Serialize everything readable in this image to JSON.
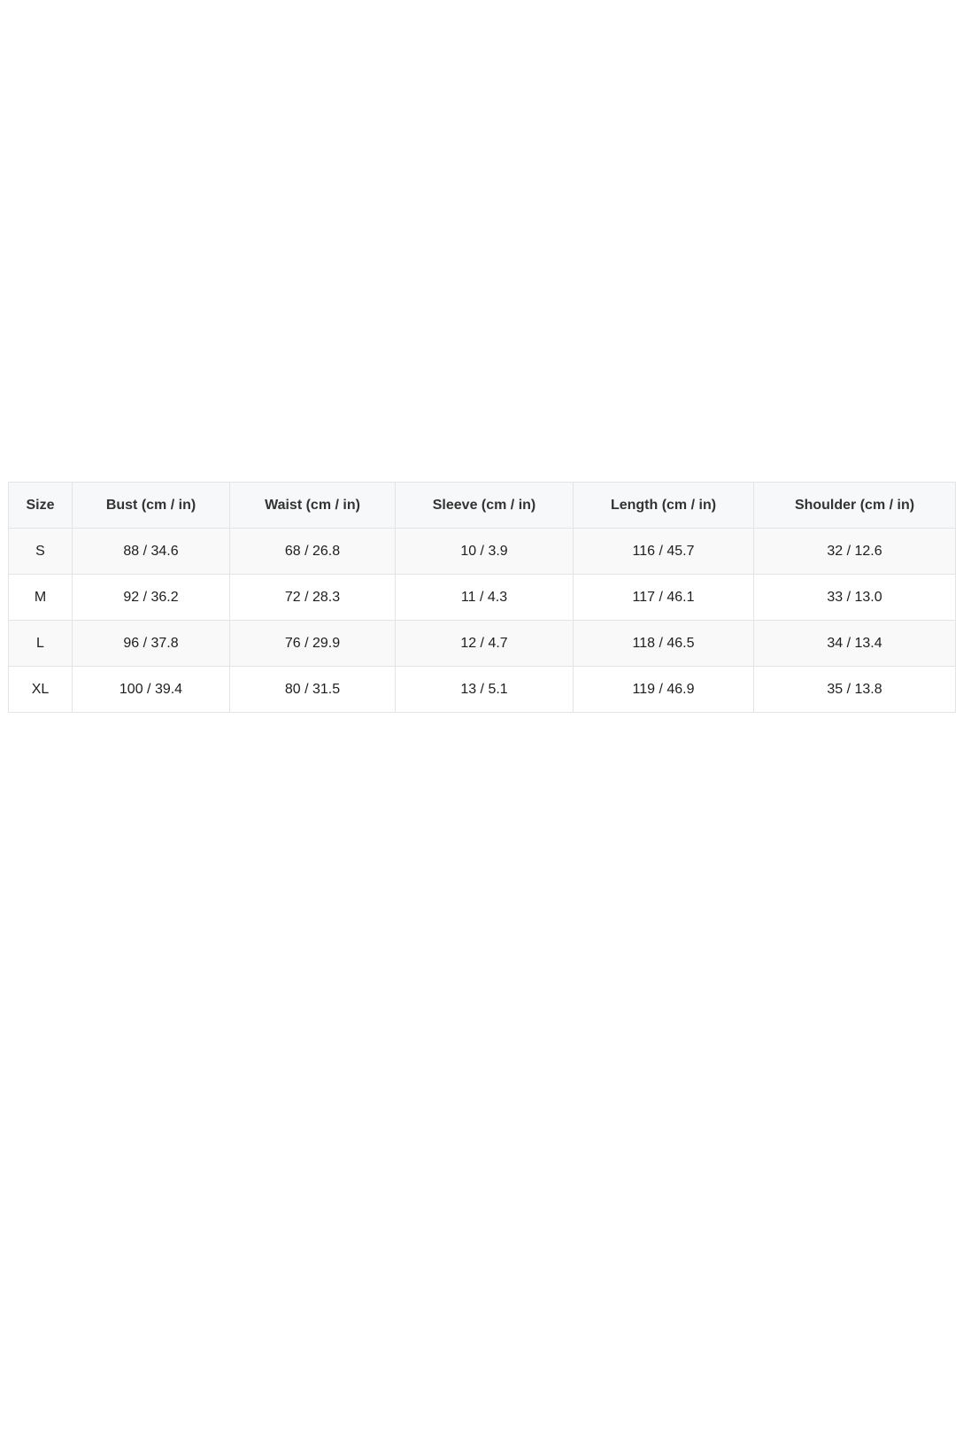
{
  "size_chart": {
    "headers": [
      "Size",
      "Bust (cm / in)",
      "Waist (cm / in)",
      "Sleeve (cm / in)",
      "Length (cm / in)",
      "Shoulder (cm / in)"
    ],
    "rows": [
      [
        "S",
        "88 / 34.6",
        "68 / 26.8",
        "10 / 3.9",
        "116 / 45.7",
        "32 / 12.6"
      ],
      [
        "M",
        "92 / 36.2",
        "72 / 28.3",
        "11 / 4.3",
        "117 / 46.1",
        "33 / 13.0"
      ],
      [
        "L",
        "96 / 37.8",
        "76 / 29.9",
        "12 / 4.7",
        "118 / 46.5",
        "34 / 13.4"
      ],
      [
        "XL",
        "100 / 39.4",
        "80 / 31.5",
        "13 / 5.1",
        "119 / 46.9",
        "35 / 13.8"
      ]
    ]
  }
}
